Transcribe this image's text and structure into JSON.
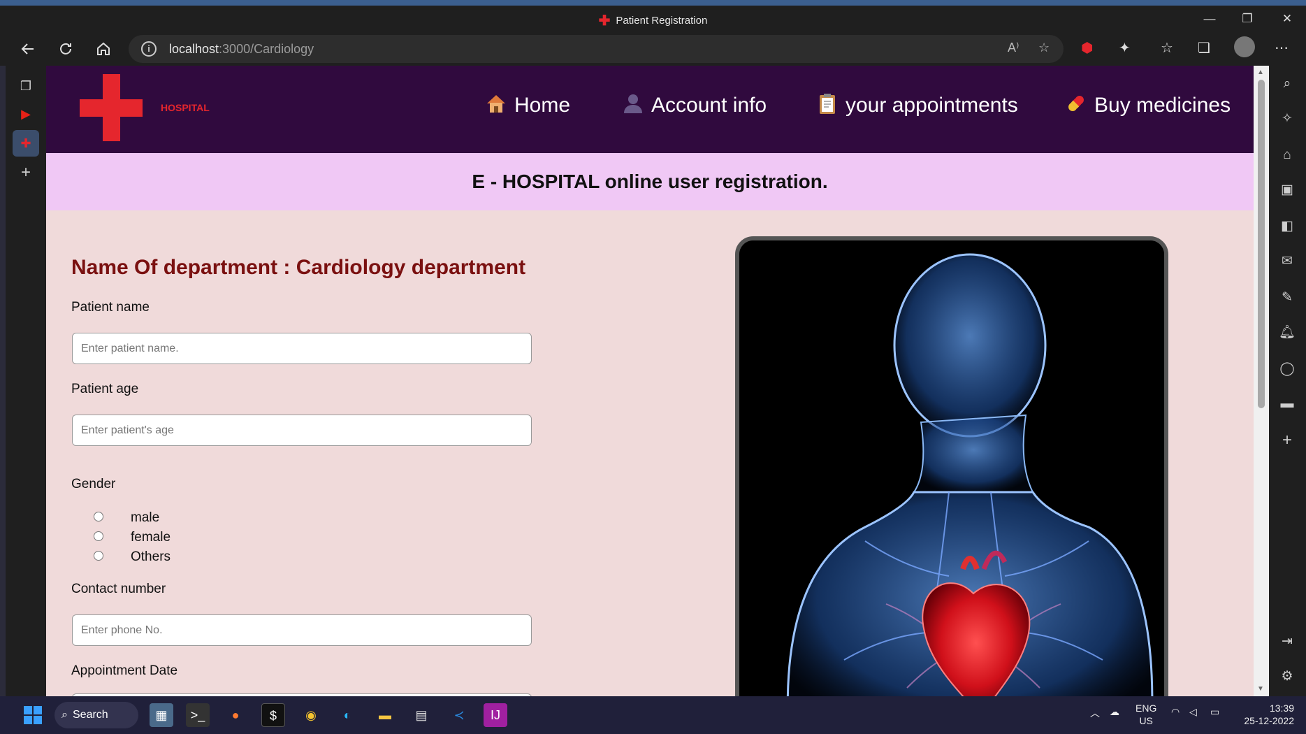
{
  "window": {
    "title": "Patient Registration",
    "controls": {
      "minimize": "—",
      "restore": "❐",
      "close": "✕"
    }
  },
  "toolbar": {
    "url_host": "localhost",
    "url_path": ":3000/Cardiology",
    "info_icon": "i"
  },
  "nav": {
    "logo_text": "HOSPITAL",
    "items": [
      {
        "label": "Home",
        "icon": "house-icon"
      },
      {
        "label": "Account info",
        "icon": "user-icon"
      },
      {
        "label": "your appointments",
        "icon": "clipboard-icon"
      },
      {
        "label": "Buy medicines",
        "icon": "pill-icon"
      }
    ]
  },
  "banner": {
    "title": "E - HOSPITAL online user registration."
  },
  "form": {
    "department_heading": "Name Of department : Cardiology department",
    "patient_name_label": "Patient name",
    "patient_name_placeholder": "Enter patient name.",
    "patient_age_label": "Patient age",
    "patient_age_placeholder": "Enter patient's age",
    "gender_label": "Gender",
    "gender_options": [
      "male",
      "female",
      "Others"
    ],
    "contact_label": "Contact number",
    "contact_placeholder": "Enter phone No.",
    "appointment_date_label": "Appointment Date"
  },
  "taskbar": {
    "search_label": "Search",
    "lang_top": "ENG",
    "lang_bottom": "US",
    "time": "13:39",
    "date": "25-12-2022"
  },
  "colors": {
    "nav_bg": "#300a3e",
    "banner_bg": "#f0c8f5",
    "page_bg": "#f0dada",
    "accent_red": "#e5262d",
    "heading_red": "#7a1010"
  }
}
